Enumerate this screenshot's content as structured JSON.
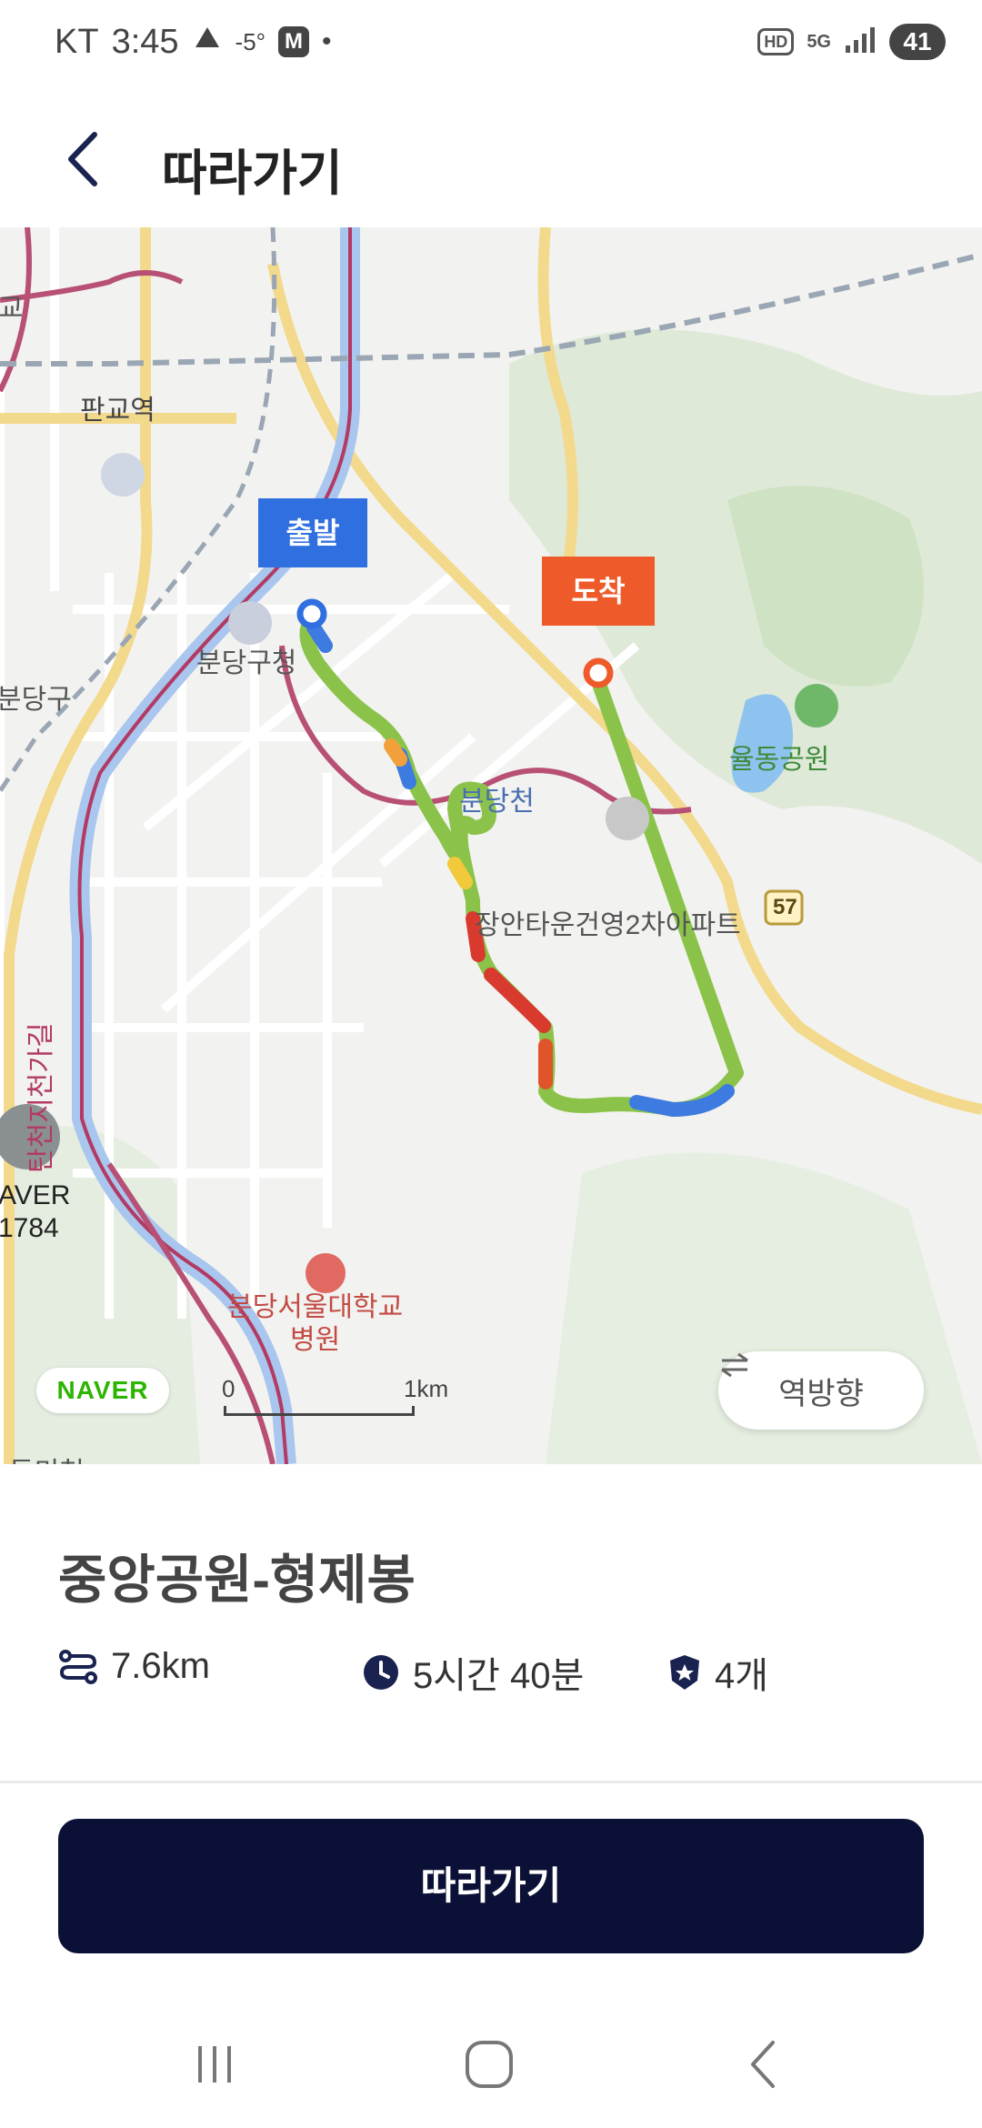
{
  "status_bar": {
    "carrier": "KT",
    "time": "3:45",
    "temperature": "-5°",
    "app_badge": "M",
    "battery": "41",
    "hd_label": "HD",
    "network": "5G"
  },
  "header": {
    "title": "따라가기"
  },
  "map": {
    "start_label": "출발",
    "end_label": "도착",
    "places": {
      "pangyo_station": "판교역",
      "bundang_office": "분당구청",
      "bundang_gu": "분당구",
      "bundang_stream": "분당천",
      "yuldong_park": "율동공원",
      "apartment": "장안타운건영2차아파트",
      "tancheon_road": "탄천지천가길",
      "hospital": "분당서울대학교\n병원",
      "naver_side_1": "AVER",
      "naver_side_2": "1784",
      "road_57": "57",
      "left_edge": "교",
      "bottom_edge": "동미천"
    },
    "naver_logo": "NAVER",
    "scale_start": "0",
    "scale_end": "1km",
    "reverse_button": "역방향"
  },
  "route": {
    "name": "중앙공원-형제봉",
    "distance": "7.6km",
    "duration": "5시간 40분",
    "badges": "4개"
  },
  "actions": {
    "follow_button": "따라가기"
  },
  "colors": {
    "primary": "#0b1136",
    "start_pin": "#2f6fe0",
    "end_pin": "#ee5a2a",
    "route_green": "#8bc34a"
  }
}
